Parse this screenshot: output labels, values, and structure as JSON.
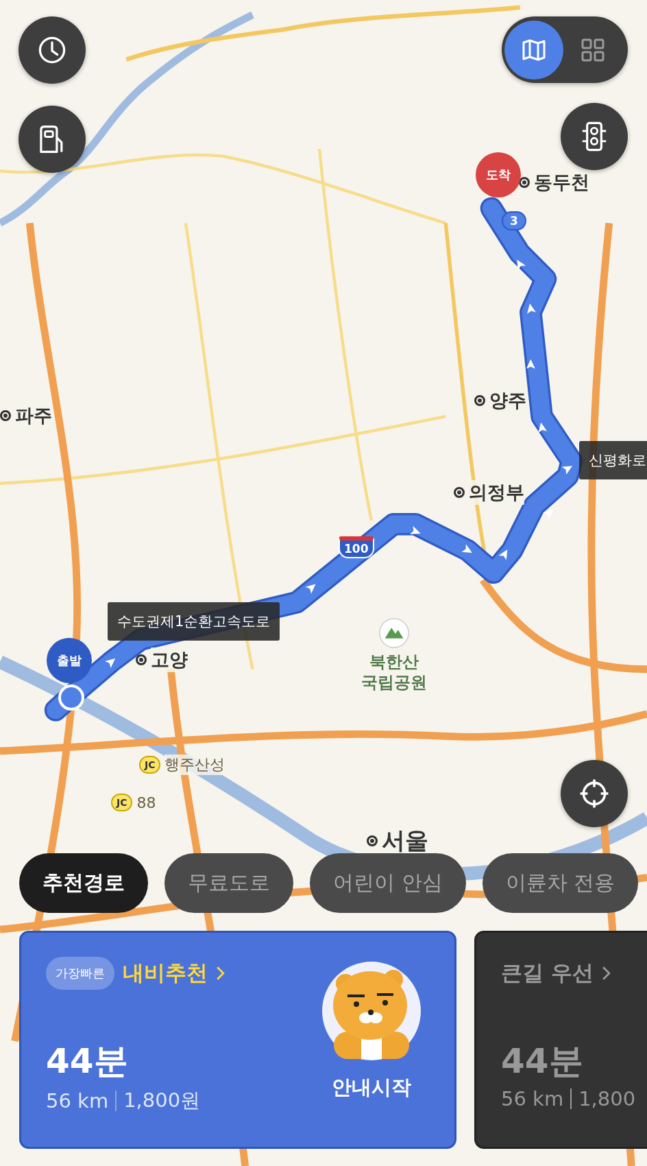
{
  "map": {
    "places": [
      {
        "kind": "city",
        "label": "동두천"
      },
      {
        "kind": "city",
        "label": "양주"
      },
      {
        "kind": "city",
        "label": "파주"
      },
      {
        "kind": "city",
        "label": "의정부"
      },
      {
        "kind": "city",
        "label": "고양"
      },
      {
        "kind": "capital",
        "label": "서울"
      },
      {
        "kind": "park",
        "label": "북한산\n국립공원"
      },
      {
        "kind": "junction",
        "label": "행주산성",
        "badge": "JC"
      },
      {
        "kind": "junction",
        "label": "88",
        "badge": "JC"
      }
    ],
    "shields": [
      {
        "kind": "national",
        "label": "3"
      },
      {
        "kind": "expressway",
        "label": "100"
      }
    ],
    "road_labels": [
      {
        "label": "수도권제1순환고속도로"
      },
      {
        "label": "신평화로"
      }
    ],
    "pins": [
      {
        "kind": "start",
        "label": "출발"
      },
      {
        "kind": "end",
        "label": "도착"
      }
    ]
  },
  "view_toggle": [
    {
      "kind": "map",
      "selected": true
    },
    {
      "kind": "grid",
      "selected": false
    }
  ],
  "route_options": [
    {
      "label": "추천경로",
      "selected": true
    },
    {
      "label": "무료도로",
      "selected": false
    },
    {
      "label": "어린이 안심",
      "selected": false
    },
    {
      "label": "이륜차 전용",
      "selected": false
    }
  ],
  "routes": [
    {
      "badge": "가장빠른",
      "title": "내비추천",
      "duration": "44분",
      "distance": "56 km",
      "toll": "1,800원",
      "action": "안내시작",
      "selected": true
    },
    {
      "title": "큰길 우선",
      "duration": "44분",
      "distance": "56 km",
      "toll": "1,800",
      "selected": false
    }
  ]
}
